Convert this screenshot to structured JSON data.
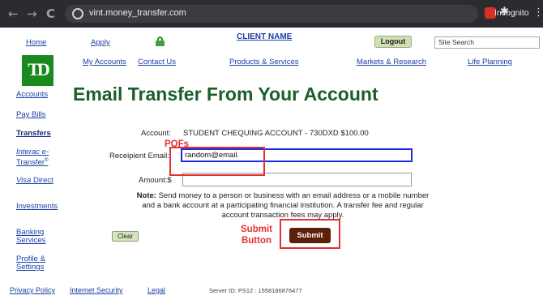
{
  "browser": {
    "back": "←",
    "forward": "→",
    "reload": "C",
    "url": "vint.money_transfer.com",
    "incognito_label": "Incognito",
    "menu": "⋮"
  },
  "topnav": {
    "home": "Home",
    "apply": "Apply",
    "client_name": "CLIENT NAME",
    "logout": "Logout",
    "site_search": "Site Search"
  },
  "brand": {
    "logo_text": "TD",
    "color": "#1a8a1f"
  },
  "mainnav": {
    "my_accounts": "My Accounts",
    "contact_us": "Contact Us",
    "products_services": "Products & Services",
    "markets_research": "Markets & Research",
    "life_planning": "Life Planning"
  },
  "sidebar": {
    "accounts": "Accounts",
    "pay_bills": "Pay Bills",
    "transfers": "Transfers",
    "interac_line1": "Interac e-",
    "interac_line2": "Transfer",
    "interac_sup": "®",
    "visa_direct_italic": "Visa",
    "visa_direct_rest": " Direct",
    "investments": "Investments",
    "banking_line1": "Banking",
    "banking_line2": "Services",
    "profile_line1": "Profile &",
    "profile_line2": "Settings"
  },
  "page": {
    "title": "Email Transfer From Your Account"
  },
  "form": {
    "account_label": "Account:",
    "account_value": "STUDENT CHEQUING ACCOUNT - 730DXD $100.00",
    "email_label": "Receipient Email:",
    "email_value": "random@email.",
    "amount_label": "Amount:$",
    "amount_value": "",
    "note_bold": "Note:",
    "note_text": " Send money to a person or business with an email address or a mobile number and a bank account at a participating financial institution. A transfer fee and regular account transaction fees may apply.",
    "clear": "Clear",
    "submit": "Submit"
  },
  "annotations": {
    "pofs": "POFs",
    "submit_line1": "Submit",
    "submit_line2": "Button",
    "color": "#e03232"
  },
  "footer": {
    "privacy": "Privacy Policy",
    "security": "Internet Security",
    "legal": "Legal",
    "server": "Server ID: PS12 : 1558186876477"
  }
}
